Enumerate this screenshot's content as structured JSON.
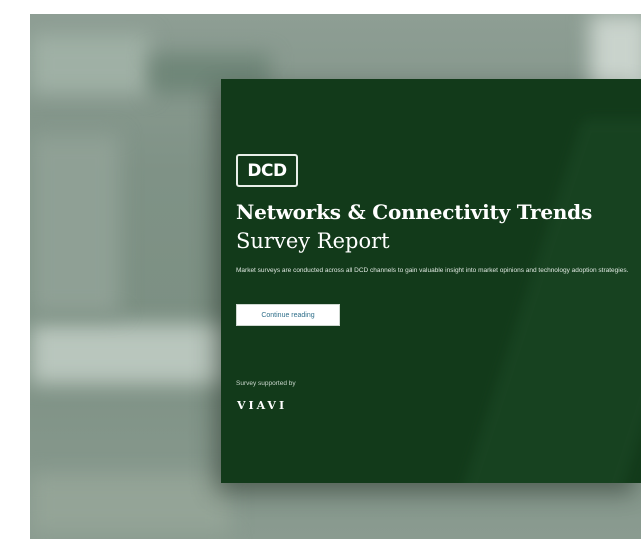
{
  "card": {
    "logo_text": "DCD",
    "title": "Networks & Connectivity Trends",
    "subtitle": "Survey Report",
    "description": "Market surveys are conducted across all DCD channels to gain valuable insight into market opinions and technology adoption strategies.",
    "cta_label": "Continue reading",
    "supported_by": "Survey supported by",
    "sponsor_name": "VIAVI"
  },
  "colors": {
    "card_background": "#123a1a",
    "backdrop": "#7f9286",
    "cta_text": "#2f6f8a"
  }
}
